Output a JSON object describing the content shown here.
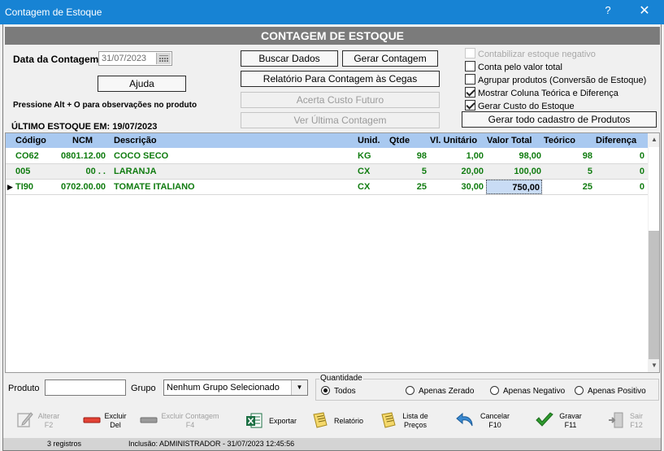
{
  "window": {
    "title": "Contagem de Estoque",
    "help": "?",
    "close": "✕"
  },
  "header": {
    "title": "CONTAGEM DE ESTOQUE"
  },
  "form": {
    "date_label": "Data da Contagem:",
    "date_value": "31/07/2023",
    "help_button": "Ajuda",
    "hint": "Pressione Alt + O para observações no produto",
    "last_stock": "ÚLTIMO ESTOQUE EM: 19/07/2023"
  },
  "buttons": {
    "buscar": "Buscar Dados",
    "gerar": "Gerar Contagem",
    "relatorio_cegas": "Relatório Para Contagem às Cegas",
    "acerta": "Acerta Custo Futuro",
    "ver_ultima": "Ver Última Contagem",
    "gerar_cadastro": "Gerar todo cadastro de Produtos"
  },
  "options": [
    {
      "label": "Contabilizar estoque negativo",
      "checked": false,
      "disabled": true
    },
    {
      "label": "Conta pelo valor total",
      "checked": false,
      "disabled": false
    },
    {
      "label": "Agrupar produtos (Conversão de Estoque)",
      "checked": false,
      "disabled": false
    },
    {
      "label": "Mostrar Coluna Teórica e Diferença",
      "checked": true,
      "disabled": false
    },
    {
      "label": "Gerar Custo do Estoque",
      "checked": true,
      "disabled": false
    }
  ],
  "table": {
    "columns": [
      "Código",
      "NCM",
      "Descrição",
      "Unid.",
      "Qtde",
      "Vl. Unitário",
      "Valor Total",
      "Teórico",
      "Diferença"
    ],
    "rows": [
      [
        "CO62",
        "0801.12.00",
        "COCO SECO",
        "KG",
        "98",
        "1,00",
        "98,00",
        "98",
        "0"
      ],
      [
        "005",
        "00 .  .",
        "LARANJA",
        "CX",
        "5",
        "20,00",
        "100,00",
        "5",
        "0"
      ],
      [
        "TI90",
        "0702.00.00",
        "TOMATE ITALIANO",
        "CX",
        "25",
        "30,00",
        "750,00",
        "25",
        "0"
      ]
    ],
    "current_row_indicator": "▶",
    "scroll_up": "▲",
    "scroll_down": "▼"
  },
  "filters": {
    "produto_label": "Produto",
    "produto_value": "",
    "grupo_label": "Grupo",
    "grupo_value": "Nenhum Grupo Selecionado",
    "grupo_arrow": "▼",
    "quantidade_label": "Quantidade",
    "quantidade_options": [
      "Todos",
      "Apenas Zerado",
      "Apenas Negativo",
      "Apenas Positivo"
    ],
    "quantidade_selected": "Todos"
  },
  "toolbar": {
    "alterar": [
      "Alterar",
      "F2"
    ],
    "excluir": [
      "Excluir",
      "Del"
    ],
    "excluir_contagem": [
      "Excluir Contagem",
      "F4"
    ],
    "exportar": "Exportar",
    "relatorio": "Relatório",
    "lista_precos": [
      "Lista de",
      "Preços"
    ],
    "cancelar": [
      "Cancelar",
      "F10"
    ],
    "gravar": [
      "Gravar",
      "F11"
    ],
    "sair": [
      "Sair",
      "F12"
    ]
  },
  "status": {
    "records": "3 registros",
    "inclusion": "Inclusão: ADMINISTRADOR - 31/07/2023 12:45:56"
  },
  "colors": {
    "titlebar": "#1783d4",
    "header_band": "#7b7b7b",
    "grid_header": "#a9c9f0",
    "row_text": "#107c10"
  }
}
